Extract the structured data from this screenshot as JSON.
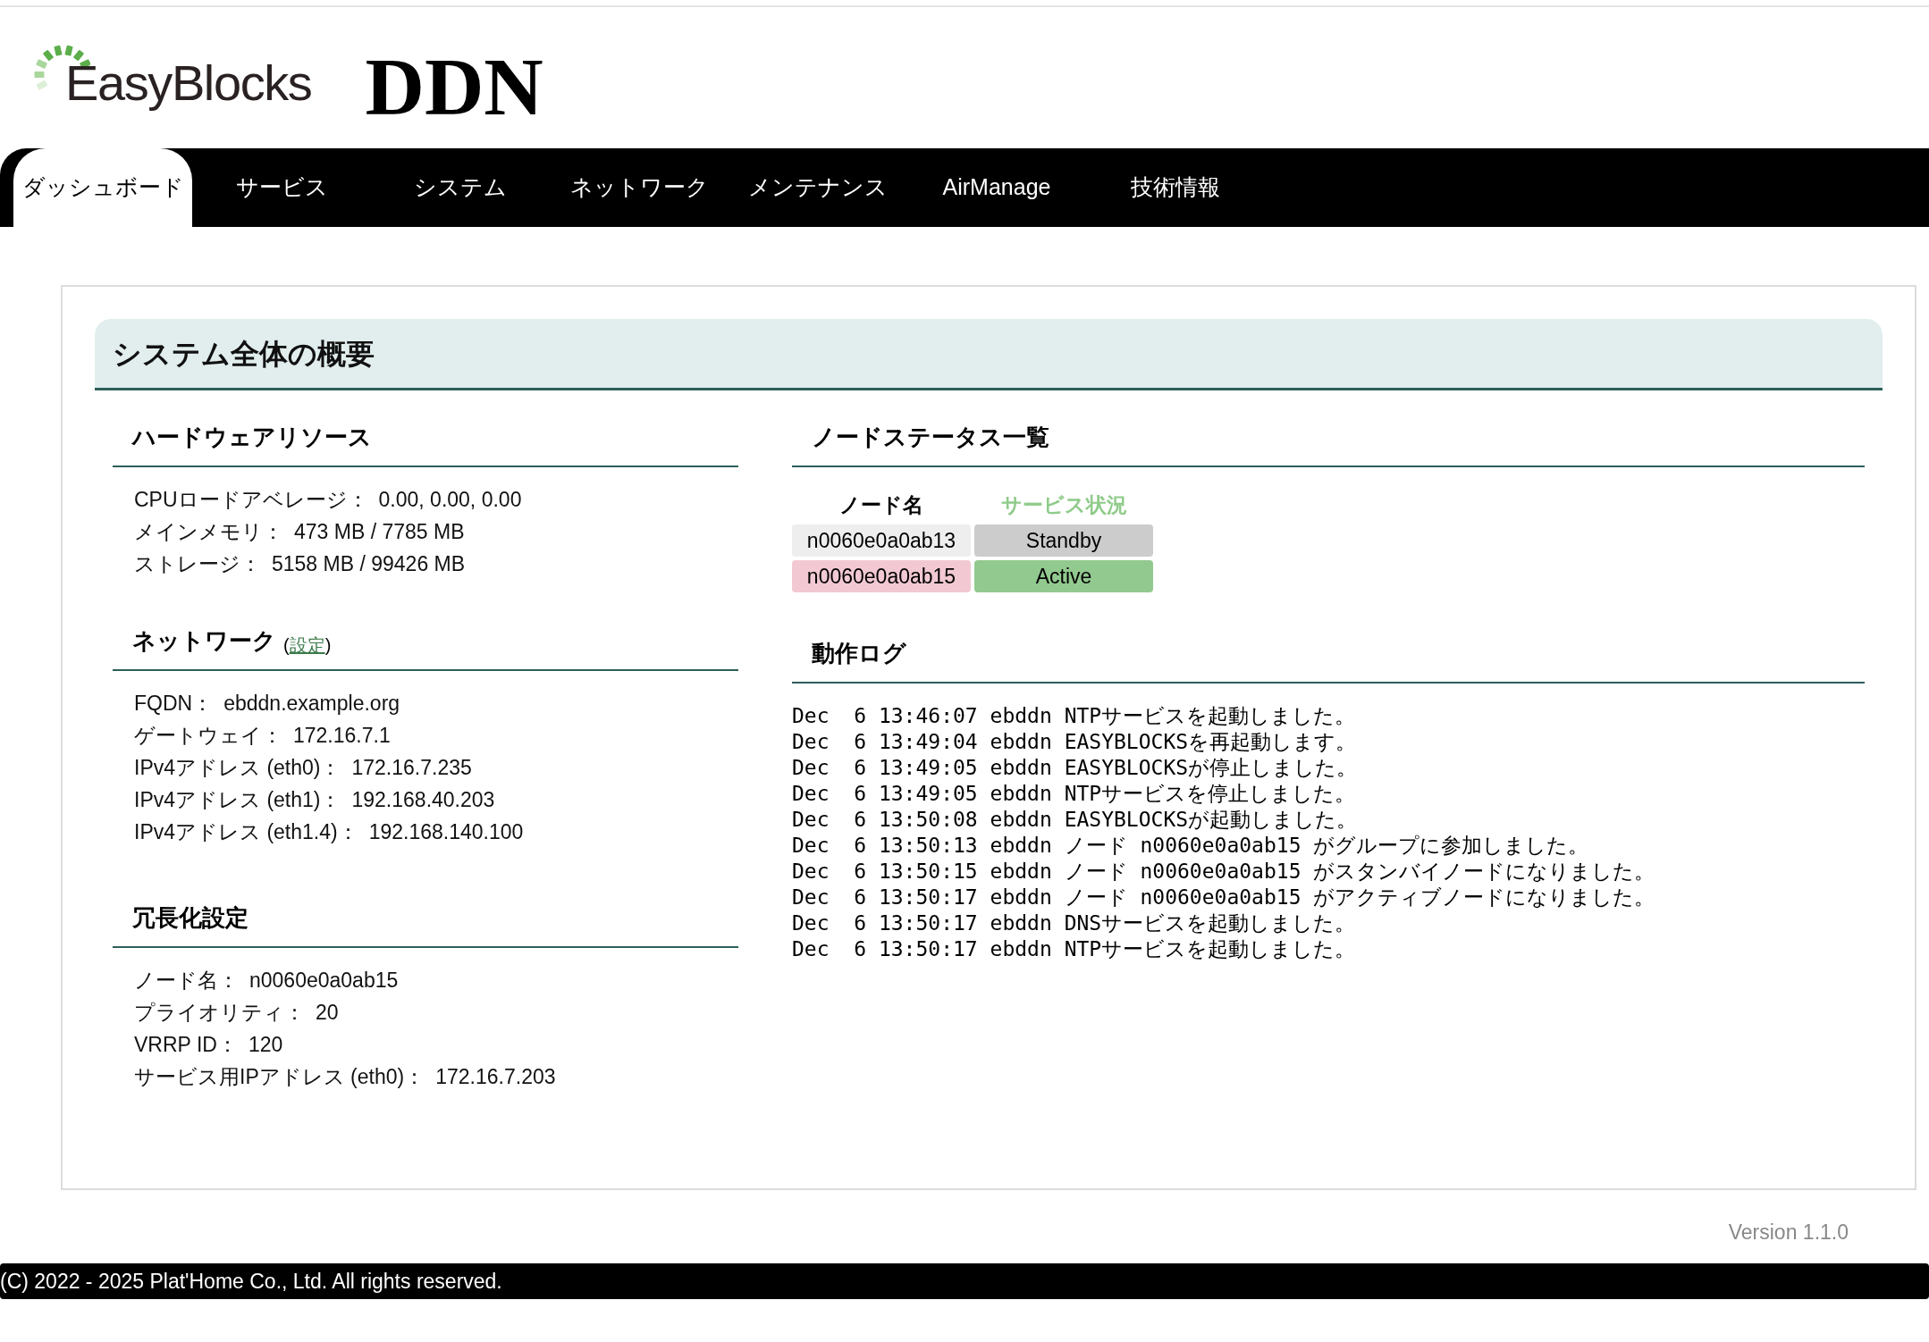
{
  "header": {
    "logo_text": "EasyBlocks",
    "product": "DDN"
  },
  "tabs": [
    {
      "label": "ダッシュボード",
      "selected": true
    },
    {
      "label": "サービス",
      "selected": false
    },
    {
      "label": "システム",
      "selected": false
    },
    {
      "label": "ネットワーク",
      "selected": false
    },
    {
      "label": "メンテナンス",
      "selected": false
    },
    {
      "label": "AirManage",
      "selected": false
    },
    {
      "label": "技術情報",
      "selected": false
    }
  ],
  "panel": {
    "title": "システム全体の概要",
    "hardware": {
      "title": "ハードウェアリソース",
      "items": [
        {
          "label": "CPUロードアベレージ：",
          "value": "0.00, 0.00, 0.00"
        },
        {
          "label": "メインメモリ：",
          "value": "473 MB / 7785 MB"
        },
        {
          "label": "ストレージ：",
          "value": "5158 MB / 99426 MB"
        }
      ]
    },
    "network": {
      "title": "ネットワーク",
      "link_open": "(",
      "link": "設定",
      "link_close": ")",
      "items": [
        {
          "label": "FQDN：",
          "value": "ebddn.example.org"
        },
        {
          "label": "ゲートウェイ：",
          "value": "172.16.7.1"
        },
        {
          "label": "IPv4アドレス (eth0)：",
          "value": "172.16.7.235"
        },
        {
          "label": "IPv4アドレス (eth1)：",
          "value": "192.168.40.203"
        },
        {
          "label": "IPv4アドレス (eth1.4)：",
          "value": "192.168.140.100"
        }
      ]
    },
    "redundancy": {
      "title": "冗長化設定",
      "items": [
        {
          "label": "ノード名：",
          "value": "n0060e0a0ab15"
        },
        {
          "label": "プライオリティ：",
          "value": "20"
        },
        {
          "label": "VRRP ID：",
          "value": "120"
        },
        {
          "label": "サービス用IPアドレス (eth0)：",
          "value": "172.16.7.203"
        }
      ]
    },
    "node_status": {
      "title": "ノードステータス一覧",
      "columns": [
        "ノード名",
        "サービス状況"
      ],
      "rows": [
        {
          "node": "n0060e0a0ab13",
          "current": false,
          "status": "Standby",
          "kind": "standby"
        },
        {
          "node": "n0060e0a0ab15",
          "current": true,
          "status": "Active",
          "kind": "active"
        }
      ]
    },
    "log": {
      "title": "動作ログ",
      "lines": [
        "Dec  6 13:46:07 ebddn NTPサービスを起動しました。",
        "Dec  6 13:49:04 ebddn EASYBLOCKSを再起動します。",
        "Dec  6 13:49:05 ebddn EASYBLOCKSが停止しました。",
        "Dec  6 13:49:05 ebddn NTPサービスを停止しました。",
        "Dec  6 13:50:08 ebddn EASYBLOCKSが起動しました。",
        "Dec  6 13:50:13 ebddn ノード n0060e0a0ab15 がグループに参加しました。",
        "Dec  6 13:50:15 ebddn ノード n0060e0a0ab15 がスタンバイノードになりました。",
        "Dec  6 13:50:17 ebddn ノード n0060e0a0ab15 がアクティブノードになりました。",
        "Dec  6 13:50:17 ebddn DNSサービスを起動しました。",
        "Dec  6 13:50:17 ebddn NTPサービスを起動しました。"
      ]
    }
  },
  "version": "Version 1.1.0",
  "footer": "(C) 2022 - 2025 Plat'Home Co., Ltd. All rights reserved."
}
